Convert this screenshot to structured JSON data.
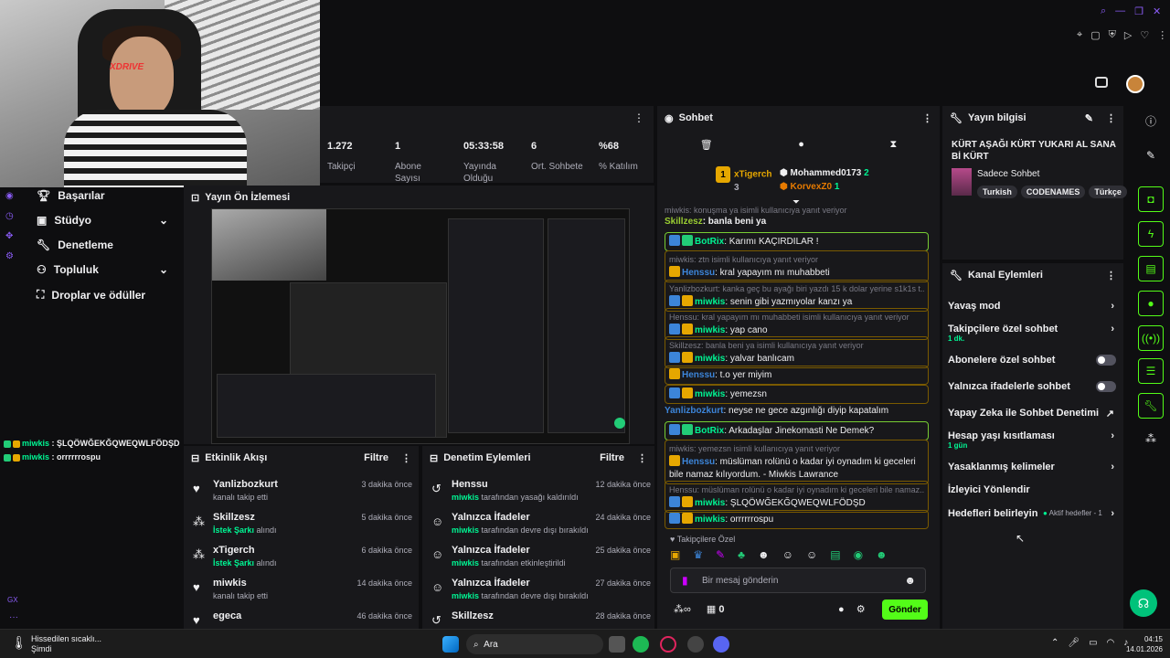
{
  "stats": [
    {
      "value": "1.272",
      "label": "Takipçi"
    },
    {
      "value": "1",
      "label": "Abone Sayısı"
    },
    {
      "value": "05:33:58",
      "label": "Yayında Olduğu"
    },
    {
      "value": "6",
      "label": "Ort. Sohbete"
    },
    {
      "value": "%68",
      "label": "% Katılım"
    }
  ],
  "nav": [
    {
      "label": "Başarılar",
      "icon": "trophy-icon"
    },
    {
      "label": "Stüdyo",
      "icon": "studio-icon"
    },
    {
      "label": "Denetleme",
      "icon": "wrench-icon"
    },
    {
      "label": "Topluluk",
      "icon": "community-icon"
    },
    {
      "label": "Droplar ve ödüller",
      "icon": "drops-icon"
    }
  ],
  "preview": {
    "title": "Yayın Ön İzlemesi"
  },
  "overlay_chat": [
    {
      "user": "miwkis",
      "text": " : ŞLQÖWĞEKĞQWEQWLFÖDŞD"
    },
    {
      "user": "miwkis",
      "text": " : orrrrrrospu"
    }
  ],
  "activity": {
    "title": "Etkinlik Akışı",
    "filter": "Filtre",
    "items": [
      {
        "name": "Yanlizbozkurt",
        "sub": "kanalı takip etti",
        "time": "3 dakika önce",
        "icon": "heart-icon"
      },
      {
        "name": "Skillzesz",
        "sub": "İstek Şarkı",
        "sub2": " alındı",
        "time": "5 dakika önce",
        "icon": "points-icon"
      },
      {
        "name": "xTigerch",
        "sub": "İstek Şarkı",
        "sub2": " alındı",
        "time": "6 dakika önce",
        "icon": "points-icon"
      },
      {
        "name": "miwkis",
        "sub": "kanalı takip etti",
        "time": "14 dakika önce",
        "icon": "heart-icon"
      },
      {
        "name": "egeca",
        "sub": "",
        "time": "46 dakika önce",
        "icon": "heart-icon"
      }
    ]
  },
  "modactions": {
    "title": "Denetim Eylemleri",
    "filter": "Filtre",
    "items": [
      {
        "name": "Henssu",
        "by": "miwkis",
        "sub": " tarafından yasağı kaldırıldı",
        "time": "12 dakika önce"
      },
      {
        "name": "Yalnızca İfadeler",
        "by": "miwkis",
        "sub": " tarafından devre dışı bırakıldı",
        "time": "24 dakika önce"
      },
      {
        "name": "Yalnızca İfadeler",
        "by": "miwkis",
        "sub": " tarafından etkinleştirildi",
        "time": "25 dakika önce"
      },
      {
        "name": "Yalnızca İfadeler",
        "by": "miwkis",
        "sub": " tarafından devre dışı bırakıldı",
        "time": "27 dakika önce"
      },
      {
        "name": "Skillzesz",
        "by": "",
        "sub": "",
        "time": "28 dakika önce"
      }
    ]
  },
  "chat": {
    "title": "Sohbet",
    "top": [
      {
        "rank": "1",
        "name": "xTigerch",
        "count": "3"
      },
      {
        "name": "Mohammed0173",
        "count": "2"
      },
      {
        "name": "KorvexZ0",
        "count": "1"
      }
    ],
    "messages": [
      {
        "reply": "miwkis: konuşma ya isimli kullanıcıya yanıt veriyor",
        "user": "",
        "text": ""
      },
      {
        "user": "Skillzesz",
        "text": ": banla beni ya",
        "color": "#9acd32"
      },
      {
        "user": "BotRix",
        "text": ": Karımı KAÇIRDILAR !",
        "color": "#00f593"
      },
      {
        "reply": "miwkis: ztn isimli kullanıcıya yanıt veriyor",
        "user": "Henssu",
        "text": ": kral yapayım mı muhabbeti",
        "color": "#3c85d9"
      },
      {
        "reply": "Yanlizbozkurt: kanka geç bu ayağı biri yazdı 15 k dolar yerine s1k1s t...",
        "user": "miwkis",
        "text": ": senin gibi yazmıyolar kanzı ya",
        "color": "#00f593"
      },
      {
        "reply": "Henssu: kral yapayım mı muhabbeti isimli kullanıcıya yanıt veriyor",
        "user": "miwkis",
        "text": ": yap cano",
        "color": "#00f593"
      },
      {
        "reply": "Skillzesz: banla beni ya isimli kullanıcıya yanıt veriyor",
        "user": "miwkis",
        "text": ": yalvar banlıcam",
        "color": "#00f593"
      },
      {
        "user": "Henssu",
        "text": ": t.o yer miyim",
        "color": "#3c85d9"
      },
      {
        "user": "miwkis",
        "text": ": yemezsn",
        "color": "#00f593"
      },
      {
        "user": "Yanlizbozkurt",
        "text": ": neyse ne gece azgınlığı diyip kapatalım",
        "color": "#3c85d9"
      },
      {
        "user": "BotRix",
        "text": ": Arkadaşlar Jinekomasti Ne Demek?",
        "color": "#00f593"
      },
      {
        "reply": "miwkis: yemezsn isimli kullanıcıya yanıt veriyor",
        "user": "Henssu",
        "text": ": müslüman rolünü o kadar iyi oynadım ki geceleri bile namaz kılıyordum. - Miwkis Lawrance",
        "color": "#3c85d9"
      },
      {
        "reply": "Henssu: müslüman rolünü o kadar iyi oynadım ki geceleri bile namaz...",
        "user": "miwkis",
        "text": ": ŞLQÖWĞEKĞQWEQWLFÖDŞD",
        "color": "#00f593"
      },
      {
        "user": "miwkis",
        "text": ": orrrrrrospu",
        "color": "#00f593"
      }
    ],
    "followers_only": "Takipçilere Özel",
    "input_placeholder": "Bir mesaj gönderin",
    "points": "0",
    "send": "Gönder"
  },
  "info": {
    "title": "Yayın bilgisi",
    "stream_title": "KÜRT AŞAĞI KÜRT YUKARI AL SANA Bİ KÜRT",
    "category": "Sadece Sohbet",
    "tags": [
      "Turkish",
      "CODENAMES",
      "Türkçe"
    ]
  },
  "channel_actions": {
    "title": "Kanal Eylemleri",
    "items": [
      {
        "label": "Yavaş mod",
        "type": "chevron"
      },
      {
        "label": "Takipçilere özel sohbet",
        "sub": "1 dk.",
        "type": "chevron"
      },
      {
        "label": "Abonelere özel sohbet",
        "type": "toggle"
      },
      {
        "label": "Yalnızca ifadelerle sohbet",
        "type": "toggle"
      },
      {
        "label": "Yapay Zeka ile Sohbet Denetimi",
        "type": "external"
      },
      {
        "label": "Hesap yaşı kısıtlaması",
        "sub": "1 gün",
        "type": "chevron"
      },
      {
        "label": "Yasaklanmış kelimeler",
        "type": "chevron"
      },
      {
        "label": "İzleyici Yönlendir",
        "type": "none"
      },
      {
        "label": "Hedefleri belirleyin",
        "extra": "Aktif hedefler - 1",
        "type": "chevron"
      }
    ]
  },
  "taskbar": {
    "weather": "Hissedilen sıcaklı...",
    "weather_sub": "Şimdi",
    "search": "Ara",
    "time": "04:15",
    "date": "14.01.2026"
  },
  "gx_label": "GX"
}
